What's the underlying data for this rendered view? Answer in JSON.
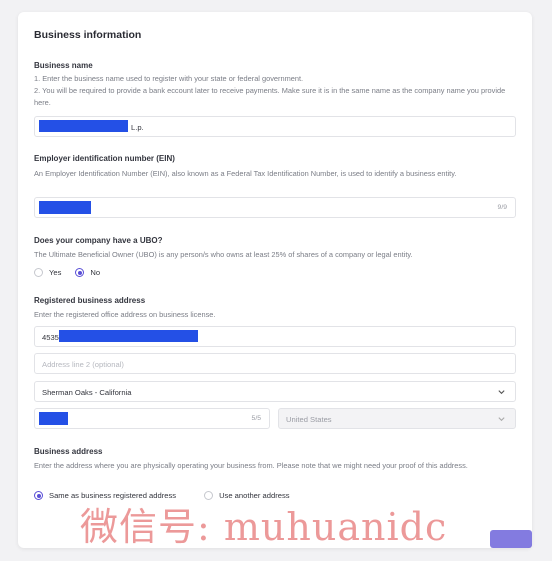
{
  "title": "Business information",
  "business_name": {
    "label": "Business name",
    "help_1": "1. Enter the business name used to register with your state or federal government.",
    "help_2": "2. You will be required to provide a bank eccount later to receive payments. Make sure it is in the same name as the company name you provide here.",
    "value_suffix": "L.p."
  },
  "ein": {
    "label": "Employer identification number (EIN)",
    "help": "An Employer Identification Number (EIN), also known as a Federal Tax Identification Number, is used to identify a business entity.",
    "count": "9/9"
  },
  "ubo": {
    "label": "Does your company have a UBO?",
    "help": "The Ultimate Beneficial Owner (UBO) is any person/s who owns at least 25% of shares of a company or legal entity.",
    "options": [
      "Yes",
      "No"
    ],
    "selected": "No"
  },
  "registered_address": {
    "label": "Registered business address",
    "help": "Enter the registered office address on business license.",
    "line1_prefix": "4535",
    "line2_placeholder": "Address line 2 (optional)",
    "city_state": "Sherman Oaks - California",
    "zip_count": "5/5",
    "country": "United States"
  },
  "business_address": {
    "label": "Business address",
    "help": "Enter the address where you are physically operating your business from. Please note that we might need your proof of this address.",
    "options": [
      "Same as business registered address",
      "Use another address"
    ],
    "selected": "Same as business registered address"
  },
  "watermark": "微信号: muhuanidc",
  "colors": {
    "accent": "#5a4fd6",
    "redaction": "#2450e6"
  }
}
